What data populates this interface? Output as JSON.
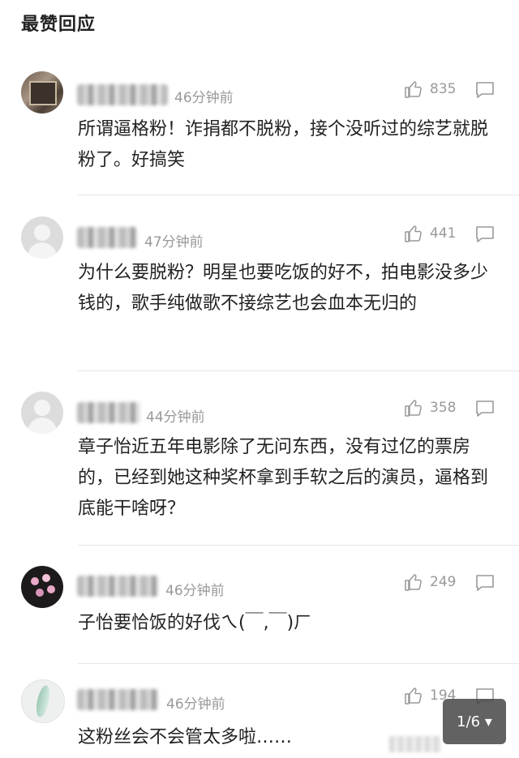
{
  "section_title": "最赞回应",
  "comments": [
    {
      "time": "46分钟前",
      "likes": "835",
      "text": "所谓逼格粉！诈捐都不脱粉，接个没听过的综艺就脱粉了。好搞笑",
      "avatar": "photo-avatar"
    },
    {
      "time": "47分钟前",
      "likes": "441",
      "text": "为什么要脱粉？明星也要吃饭的好不，拍电影没多少钱的，歌手纯做歌不接综艺也会血本无归的",
      "avatar": "default-avatar"
    },
    {
      "time": "44分钟前",
      "likes": "358",
      "text": "章子怡近五年电影除了无问东西，没有过亿的票房的，已经到她这种奖杯拿到手软之后的演员，逼格到底能干啥呀？",
      "avatar": "default-avatar"
    },
    {
      "time": "46分钟前",
      "likes": "249",
      "text": "子怡要恰饭的好伐ㄟ(￣,￣)ㄏ",
      "avatar": "flower-avatar"
    },
    {
      "time": "46分钟前",
      "likes": "194",
      "text": "这粉丝会不会管太多啦……",
      "avatar": "leaf-avatar"
    }
  ],
  "pager": {
    "label": "1/6 ▾"
  },
  "icons": {
    "like": "thumbs-up-icon",
    "reply": "comment-bubble-icon"
  },
  "colors": {
    "meta_gray": "#999999",
    "text": "#222222"
  }
}
